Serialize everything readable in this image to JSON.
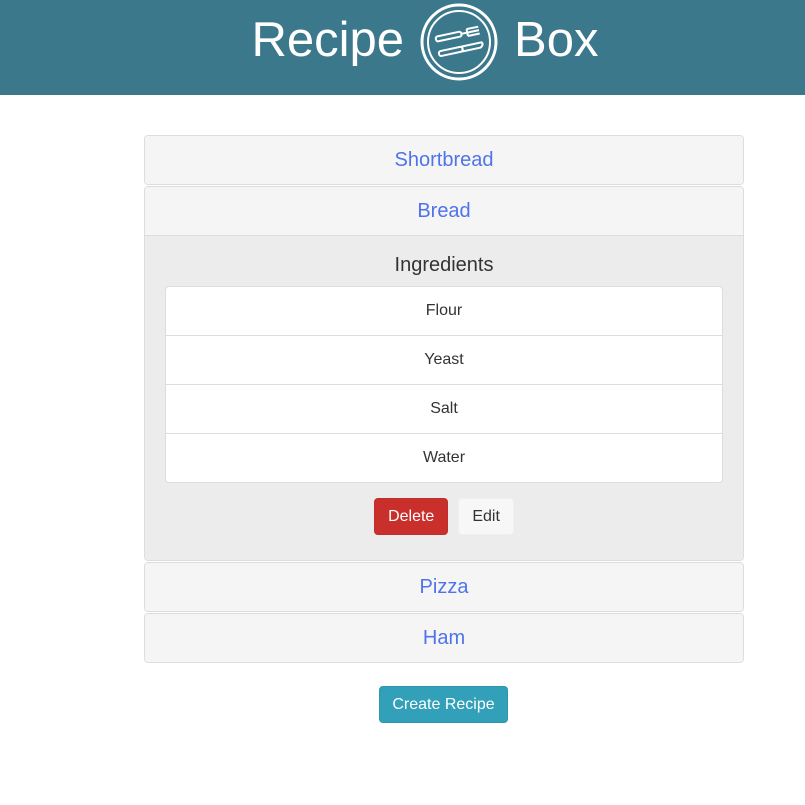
{
  "header": {
    "title_left": "Recipe",
    "title_right": "Box",
    "logo_icon": "fork-knife-plate-icon",
    "background_color": "#3b788c"
  },
  "recipes": [
    {
      "name": "Shortbread",
      "open": false
    },
    {
      "name": "Bread",
      "open": true
    },
    {
      "name": "Pizza",
      "open": false
    },
    {
      "name": "Ham",
      "open": false
    }
  ],
  "open_recipe": {
    "ingredients_heading": "Ingredients",
    "ingredients": [
      "Flour",
      "Yeast",
      "Salt",
      "Water"
    ],
    "delete_label": "Delete",
    "edit_label": "Edit"
  },
  "create_label": "Create Recipe",
  "colors": {
    "link": "#4f73ea",
    "delete": "#c9302c",
    "create": "#31a0b8"
  }
}
